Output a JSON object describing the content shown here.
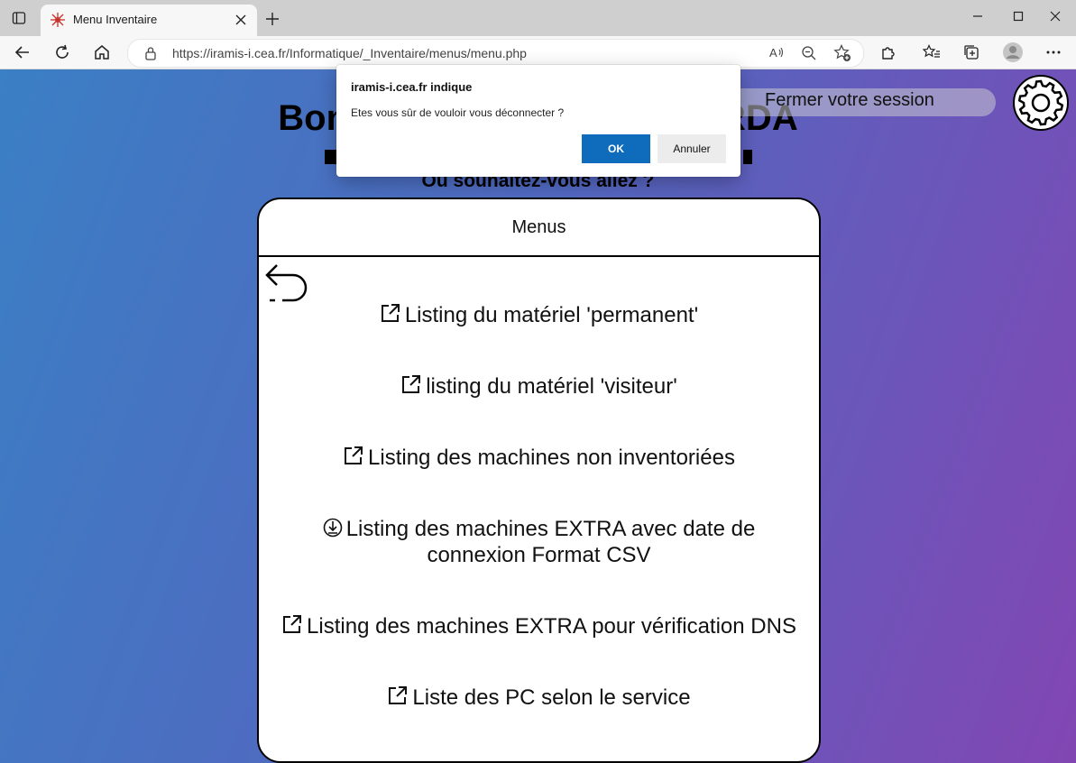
{
  "browser": {
    "tab_title": "Menu Inventaire",
    "url": "https://iramis-i.cea.fr/Informatique/_Inventaire/menus/menu.php",
    "icons": [
      "tab-actions-icon",
      "favicon-icon",
      "close-icon",
      "plus-icon",
      "minimize-icon",
      "maximize-icon",
      "window-close-icon",
      "back-arrow-icon",
      "refresh-icon",
      "home-icon",
      "lock-icon",
      "read-aloud-icon",
      "zoom-out-icon",
      "favorite-add-icon",
      "extensions-icon",
      "favorites-icon",
      "collections-icon",
      "profile-icon",
      "more-icon"
    ]
  },
  "page": {
    "session_button": "Fermer votre session",
    "welcome_prefix": "Bon",
    "welcome_suffix": "RDA",
    "question": "Ou souhaitez-vous allez ?",
    "card_title": "Menus",
    "menu_items": [
      {
        "label": "Listing du matériel 'permanent'",
        "icon": "external-link-icon"
      },
      {
        "label": "listing du matériel 'visiteur'",
        "icon": "external-link-icon"
      },
      {
        "label": "Listing des machines non inventoriées",
        "icon": "external-link-icon"
      },
      {
        "label_line1": "Listing des machines EXTRA avec date de",
        "label_line2": "connexion Format CSV",
        "icon": "download-icon"
      },
      {
        "label": "Listing des machines EXTRA pour vérification DNS",
        "icon": "external-link-icon"
      },
      {
        "label": "Liste des PC selon le service",
        "icon": "external-link-icon"
      }
    ],
    "colors": {
      "gradient_start": "#3b7fc4",
      "gradient_end": "#8246b3"
    }
  },
  "dialog": {
    "title": "iramis-i.cea.fr indique",
    "message": "Etes vous sûr de vouloir vous déconnecter ?",
    "ok_label": "OK",
    "cancel_label": "Annuler",
    "ok_color": "#0f6cbd"
  }
}
